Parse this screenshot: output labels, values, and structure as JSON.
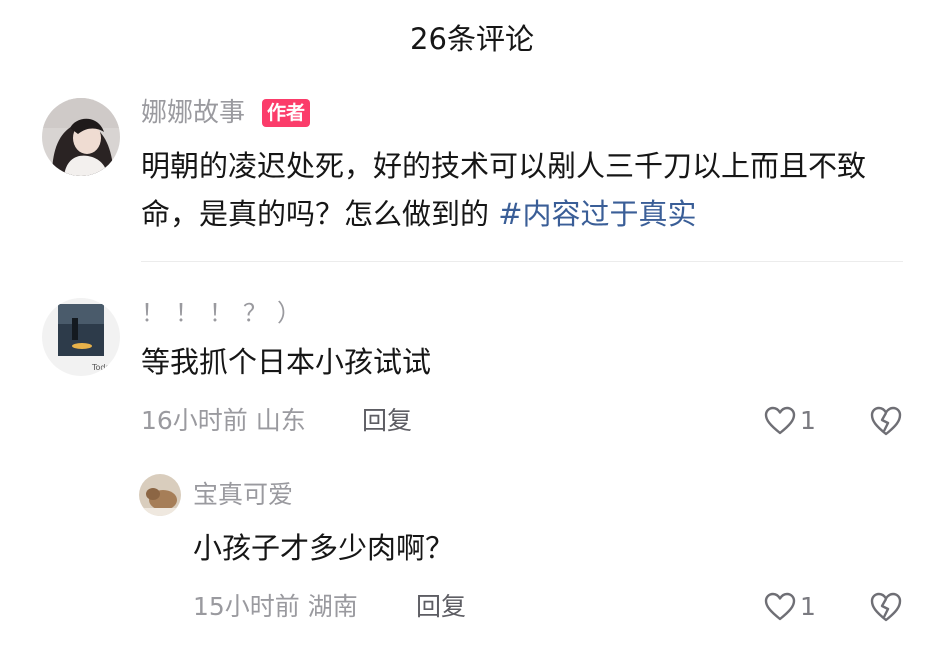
{
  "header": {
    "title": "26条评论"
  },
  "post": {
    "author": "娜娜故事",
    "badge": "作者",
    "text": "明朝的凌迟处死，好的技术可以剐人三千刀以上而且不致命，是真的吗？怎么做到的",
    "hashtag": "#内容过于真实",
    "avatar_icon": "woman-portrait-avatar"
  },
  "comments": [
    {
      "username": "！！！？）",
      "text": "等我抓个日本小孩试试",
      "time": "16小时前",
      "location": "山东",
      "reply_label": "回复",
      "likes": "1",
      "avatar_icon": "night-photo-avatar"
    },
    {
      "username": "宝真可爱",
      "text": "小孩子才多少肉啊？",
      "time": "15小时前",
      "location": "湖南",
      "reply_label": "回复",
      "likes": "1",
      "avatar_icon": "cat-photo-avatar"
    }
  ],
  "colors": {
    "badge": "#fb3c6a",
    "hashtag": "#3a5e97",
    "secondary_text": "#9a9a9f",
    "primary_text": "#161616"
  }
}
